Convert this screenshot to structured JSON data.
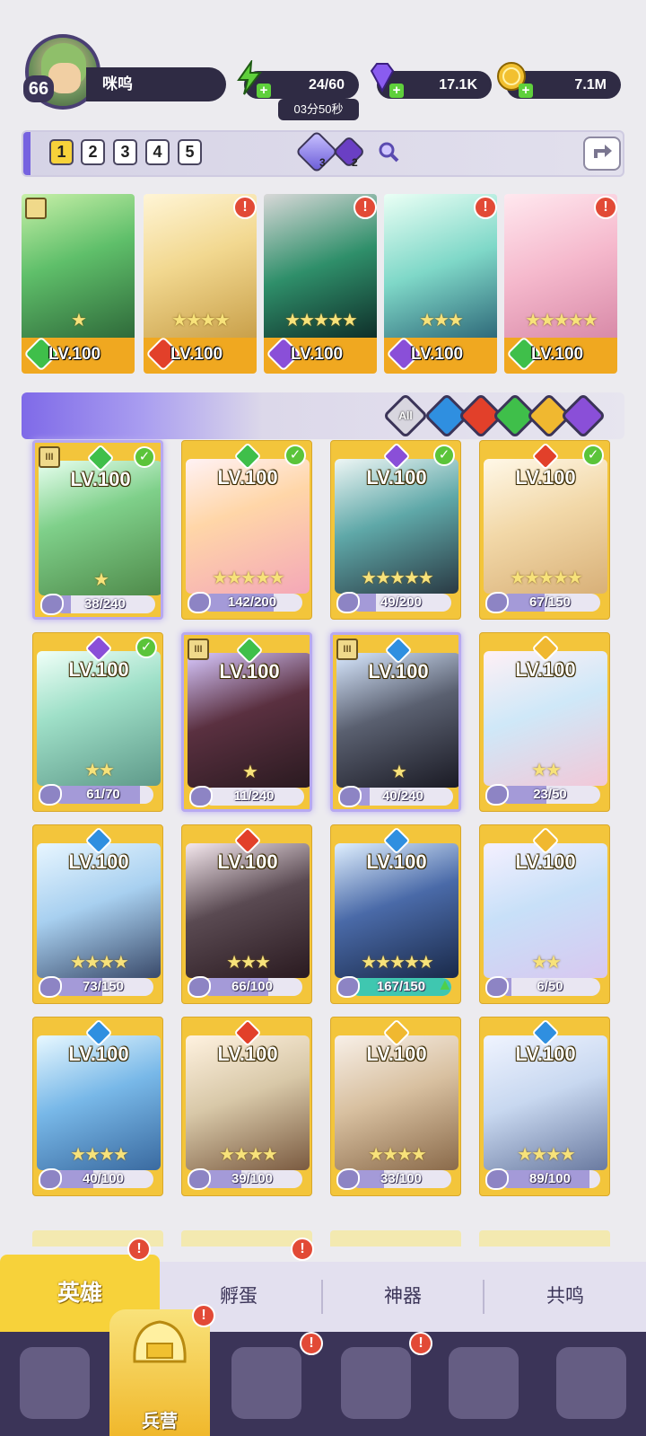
{
  "player": {
    "level": "66",
    "name": "咪呜"
  },
  "resources": {
    "stamina": "24/60",
    "stamina_timer": "03分50秒",
    "gems": "17.1K",
    "gold": "7.1M"
  },
  "team_tabs": [
    "1",
    "2",
    "3",
    "4",
    "5"
  ],
  "currency_counts": {
    "crystal_a": "3",
    "crystal_b": "2"
  },
  "team": [
    {
      "level": "LV.100",
      "element": "wind",
      "stars": "★",
      "alert": false,
      "emblem": true
    },
    {
      "level": "LV.100",
      "element": "fire",
      "stars": "★★★★",
      "alert": true,
      "emblem": false
    },
    {
      "level": "LV.100",
      "element": "dark",
      "stars": "★★★★★",
      "alert": true,
      "emblem": false
    },
    {
      "level": "LV.100",
      "element": "dark",
      "stars": "★★★",
      "alert": true,
      "emblem": false
    },
    {
      "level": "LV.100",
      "element": "wind",
      "stars": "★★★★★",
      "alert": true,
      "emblem": false
    }
  ],
  "filters": {
    "all_label": "All",
    "elements": [
      "water",
      "fire",
      "wind",
      "light",
      "dark"
    ]
  },
  "heroes": [
    {
      "level": "LV.100",
      "element": "wind",
      "shards": "38/240",
      "progress": 0.16,
      "checked": true,
      "emblem": true,
      "special": true,
      "stars": "★"
    },
    {
      "level": "LV.100",
      "element": "wind",
      "shards": "142/200",
      "progress": 0.71,
      "checked": true,
      "emblem": false,
      "special": false,
      "stars": "★★★★★"
    },
    {
      "level": "LV.100",
      "element": "dark",
      "shards": "49/200",
      "progress": 0.25,
      "checked": true,
      "emblem": false,
      "special": false,
      "stars": "★★★★★"
    },
    {
      "level": "LV.100",
      "element": "fire",
      "shards": "67/150",
      "progress": 0.45,
      "checked": true,
      "emblem": false,
      "special": false,
      "stars": "★★★★★"
    },
    {
      "level": "LV.100",
      "element": "dark",
      "shards": "61/70",
      "progress": 0.87,
      "checked": true,
      "emblem": false,
      "special": false,
      "stars": "★★"
    },
    {
      "level": "LV.100",
      "element": "wind",
      "shards": "11/240",
      "progress": 0.05,
      "checked": false,
      "emblem": true,
      "special": true,
      "stars": "★"
    },
    {
      "level": "LV.100",
      "element": "water",
      "shards": "40/240",
      "progress": 0.17,
      "checked": false,
      "emblem": true,
      "special": true,
      "stars": "★"
    },
    {
      "level": "LV.100",
      "element": "light",
      "shards": "23/50",
      "progress": 0.46,
      "checked": false,
      "emblem": false,
      "special": false,
      "stars": "★★"
    },
    {
      "level": "LV.100",
      "element": "water",
      "shards": "73/150",
      "progress": 0.49,
      "checked": false,
      "emblem": false,
      "special": false,
      "stars": "★★★★"
    },
    {
      "level": "LV.100",
      "element": "fire",
      "shards": "66/100",
      "progress": 0.66,
      "checked": false,
      "emblem": false,
      "special": false,
      "stars": "★★★"
    },
    {
      "level": "LV.100",
      "element": "water",
      "shards": "167/150",
      "progress": 1.0,
      "checked": false,
      "emblem": false,
      "special": false,
      "stars": "★★★★★"
    },
    {
      "level": "LV.100",
      "element": "light",
      "shards": "6/50",
      "progress": 0.12,
      "checked": false,
      "emblem": false,
      "special": false,
      "stars": "★★"
    },
    {
      "level": "LV.100",
      "element": "water",
      "shards": "40/100",
      "progress": 0.4,
      "checked": false,
      "emblem": false,
      "special": false,
      "stars": "★★★★"
    },
    {
      "level": "LV.100",
      "element": "fire",
      "shards": "39/100",
      "progress": 0.39,
      "checked": false,
      "emblem": false,
      "special": false,
      "stars": "★★★★"
    },
    {
      "level": "LV.100",
      "element": "light",
      "shards": "33/100",
      "progress": 0.33,
      "checked": false,
      "emblem": false,
      "special": false,
      "stars": "★★★★"
    },
    {
      "level": "LV.100",
      "element": "water",
      "shards": "89/100",
      "progress": 0.89,
      "checked": false,
      "emblem": false,
      "special": false,
      "stars": "★★★★"
    }
  ],
  "subtabs": [
    {
      "label": "英雄",
      "active": true,
      "alert": true
    },
    {
      "label": "孵蛋",
      "active": false,
      "alert": true
    },
    {
      "label": "神器",
      "active": false,
      "alert": false
    },
    {
      "label": "共鸣",
      "active": false,
      "alert": false
    }
  ],
  "nav": {
    "active_label": "兵营"
  },
  "colors": {
    "wind": "#3fbf4a",
    "fire": "#e2402a",
    "water": "#2f8fe0",
    "dark": "#8a4fd8",
    "light": "#f0b830",
    "accent": "#7662e0",
    "gold": "#f7d23a"
  }
}
